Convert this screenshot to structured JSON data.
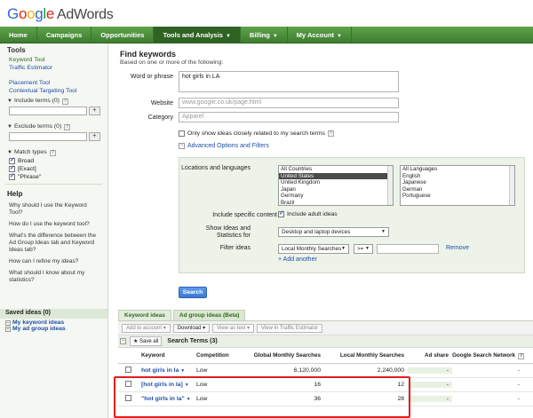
{
  "brand": {
    "logo_letters": [
      "G",
      "o",
      "o",
      "g",
      "l",
      "e"
    ],
    "product": "AdWords"
  },
  "nav": [
    {
      "label": "Home",
      "caret": false
    },
    {
      "label": "Campaigns",
      "caret": false
    },
    {
      "label": "Opportunities",
      "caret": false
    },
    {
      "label": "Tools and Analysis",
      "caret": true
    },
    {
      "label": "Billing",
      "caret": true
    },
    {
      "label": "My Account",
      "caret": true
    }
  ],
  "sidebar": {
    "tools_heading": "Tools",
    "tools": [
      "Keyword Tool",
      "Traffic Estimator",
      "Placement Tool",
      "Contextual Targeting Tool"
    ],
    "include_terms": "Include terms (0)",
    "exclude_terms": "Exclude terms (0)",
    "add_symbol": "+",
    "match_types": "Match types",
    "broad": "Broad",
    "exact": "[Exact]",
    "phrase": "\"Phrase\"",
    "help_heading": "Help",
    "help_questions": [
      "Why should I use the Keyword Tool?",
      "How do I use the keyword tool?",
      "What's the difference between the Ad Group Ideas tab and Keyword Ideas tab?",
      "How can I refine my ideas?",
      "What should I know about my statistics?"
    ],
    "saved_heading": "Saved ideas (0)",
    "saved_items": [
      "My keyword ideas",
      "My ad group ideas"
    ]
  },
  "find": {
    "title": "Find keywords",
    "subtitle": "Based on one or more of the following:",
    "word_label": "Word or phrase",
    "word_value": "hot girls in LA",
    "website_label": "Website",
    "website_placeholder": "www.google.co.uk/page.html",
    "category_label": "Category",
    "category_placeholder": "Apparel",
    "only_closely": "Only show ideas closely related to my search terms",
    "advanced_link": "Advanced Options and Filters",
    "help_q": "?"
  },
  "advanced": {
    "locations_label": "Locations and languages",
    "locations": [
      "All Countries",
      "United States",
      "United Kingdom",
      "Japan",
      "Germany",
      "Brazil"
    ],
    "languages": [
      "All Languages",
      "English",
      "Japanese",
      "German",
      "Portuguese"
    ],
    "include_content_label": "Include specific content",
    "include_adult": "Include adult ideas",
    "show_ideas_label": "Show Ideas and Statistics for",
    "device_value": "Desktop and laptop devices",
    "filter_label": "Filter ideas",
    "filter_field": "Local Monthly Searches",
    "filter_op": ">=",
    "remove": "Remove",
    "add_another": "+ Add another"
  },
  "search_button": "Search",
  "results": {
    "tabs": [
      "Keyword ideas",
      "Ad group ideas (Beta)"
    ],
    "toolbar": [
      "Add to account",
      "Download",
      "View as text",
      "View in Traffic Estimator"
    ],
    "save_all": "Save all",
    "section_title": "Search Terms (3)",
    "columns": [
      "Keyword",
      "Competition",
      "Global Monthly Searches",
      "Local Monthly Searches",
      "Ad share",
      "Google Search Network"
    ],
    "rows": [
      {
        "keyword": "hot girls in la",
        "competition": "Low",
        "global": "6,120,000",
        "local": "2,240,000",
        "ad_share": "-",
        "gsn": "-"
      },
      {
        "keyword": "[hot girls in la]",
        "competition": "Low",
        "global": "16",
        "local": "12",
        "ad_share": "-",
        "gsn": "-"
      },
      {
        "keyword": "\"hot girls in la\"",
        "competition": "Low",
        "global": "36",
        "local": "28",
        "ad_share": "-",
        "gsn": "-"
      }
    ]
  },
  "colors": {
    "nav_green": "#4d8e3c",
    "link_blue": "#1f4ea3",
    "highlight_red": "#e21d1d",
    "search_blue": "#4b8be0"
  }
}
